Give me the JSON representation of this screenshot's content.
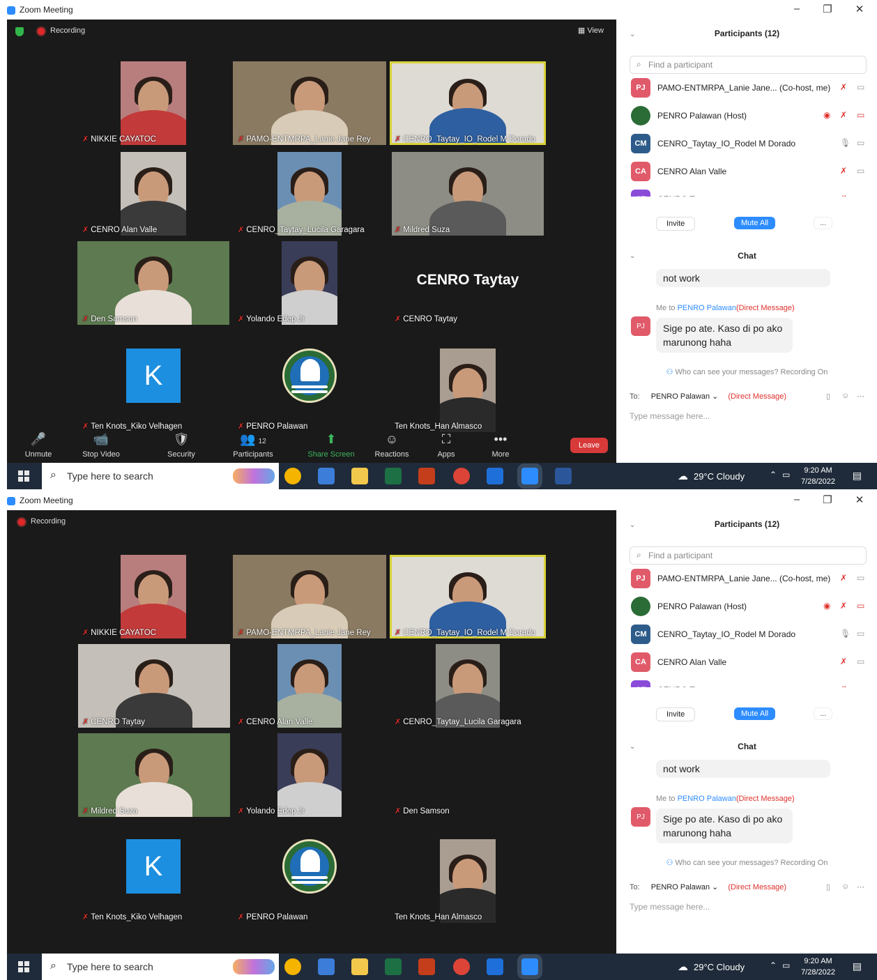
{
  "screens": [
    {
      "window_title": "Zoom Meeting",
      "recording_label": "Recording",
      "view_label": "View",
      "tiles": [
        {
          "name": "NIKKIE CAYATOC",
          "kind": "video"
        },
        {
          "name": "PAMO-ENTMRPA_Lanie Jane Rey",
          "kind": "video"
        },
        {
          "name": "CENRO_Taytay_IO_Rodel M Dorado",
          "kind": "video",
          "active": true
        },
        {
          "name": "CENRO Alan Valle",
          "kind": "video"
        },
        {
          "name": "CENRO_Taytay_Lucila Garagara",
          "kind": "video"
        },
        {
          "name": "Mildred Suza",
          "kind": "video"
        },
        {
          "name": "Den Samson",
          "kind": "video"
        },
        {
          "name": "Yolando Edep Jr",
          "kind": "video"
        },
        {
          "name": "CENRO Taytay",
          "kind": "name",
          "big_text": "CENRO Taytay"
        },
        {
          "name": "Ten Knots_Kiko Velhagen",
          "kind": "initial",
          "initial": "K"
        },
        {
          "name": "PENRO Palawan",
          "kind": "logo"
        },
        {
          "name": "Ten Knots_Han Almasco",
          "kind": "video",
          "no_mic": true
        }
      ],
      "controls": [
        {
          "label": "Unmute",
          "icon": "🎤"
        },
        {
          "label": "Stop Video",
          "icon": "📹"
        },
        {
          "label": "Security",
          "icon": "🛡"
        },
        {
          "label": "Participants",
          "icon": "👥",
          "count": "12"
        },
        {
          "label": "Share Screen",
          "icon": "⬆",
          "green": true
        },
        {
          "label": "Reactions",
          "icon": "☺"
        },
        {
          "label": "Apps",
          "icon": "⛶"
        },
        {
          "label": "More",
          "icon": "•••"
        }
      ],
      "leave_label": "Leave",
      "participants_title": "Participants (12)",
      "find_placeholder": "Find a participant",
      "participants": [
        {
          "initials": "PJ",
          "name": "PAMO-ENTMRPA_Lanie Jane... (Co-host, me)",
          "color": "#e05a6a"
        },
        {
          "initials": "",
          "name": "PENRO Palawan (Host)",
          "color": "#2a6b36",
          "logo": true
        },
        {
          "initials": "CM",
          "name": "CENRO_Taytay_IO_Rodel M Dorado",
          "color": "#2e5c8a"
        },
        {
          "initials": "CA",
          "name": "CENRO Alan Valle",
          "color": "#e05a6a"
        },
        {
          "initials": "CT",
          "name": "CENRO Taytay",
          "color": "#8a4bd8"
        }
      ],
      "invite_label": "Invite",
      "mute_all_label": "Mute All",
      "more_label": "...",
      "chat_title": "Chat",
      "chat_prev": "not work",
      "chat_meta_prefix": "Me to",
      "chat_meta_target": "PENRO Palawan",
      "chat_meta_suffix": "(Direct Message)",
      "chat_avatar": "PJ",
      "chat_msg": "Sige po ate. Kaso di po ako marunong haha",
      "who_can_see": "Who can see your messages? Recording On",
      "to_label": "To:",
      "to_target": "PENRO Palawan ⌄",
      "to_dm": "(Direct Message)",
      "message_placeholder": "Type message here...",
      "taskbar_search": "Type here to search",
      "weather": "29°C  Cloudy",
      "time": "9:20 AM",
      "date": "7/28/2022"
    },
    {
      "window_title": "Zoom Meeting",
      "recording_label": "Recording",
      "view_label": "",
      "tiles": [
        {
          "name": "NIKKIE CAYATOC",
          "kind": "video"
        },
        {
          "name": "PAMO-ENTMRPA_Lanie Jane Rey",
          "kind": "video"
        },
        {
          "name": "CENRO_Taytay_IO_Rodel M Dorado",
          "kind": "video",
          "active": true
        },
        {
          "name": "CENRO Taytay",
          "kind": "video"
        },
        {
          "name": "CENRO Alan Valle",
          "kind": "video"
        },
        {
          "name": "CENRO_Taytay_Lucila Garagara",
          "kind": "video"
        },
        {
          "name": "Mildred Suza",
          "kind": "video"
        },
        {
          "name": "Yolando Edep Jr",
          "kind": "video"
        },
        {
          "name": "Den Samson",
          "kind": "empty"
        },
        {
          "name": "Ten Knots_Kiko Velhagen",
          "kind": "initial",
          "initial": "K"
        },
        {
          "name": "PENRO Palawan",
          "kind": "logo"
        },
        {
          "name": "Ten Knots_Han Almasco",
          "kind": "video",
          "no_mic": true
        }
      ],
      "controls": [],
      "leave_label": "",
      "participants_title": "Participants (12)",
      "find_placeholder": "Find a participant",
      "participants": [
        {
          "initials": "PJ",
          "name": "PAMO-ENTMRPA_Lanie Jane... (Co-host, me)",
          "color": "#e05a6a"
        },
        {
          "initials": "",
          "name": "PENRO Palawan (Host)",
          "color": "#2a6b36",
          "logo": true
        },
        {
          "initials": "CM",
          "name": "CENRO_Taytay_IO_Rodel M Dorado",
          "color": "#2e5c8a"
        },
        {
          "initials": "CA",
          "name": "CENRO Alan Valle",
          "color": "#e05a6a"
        },
        {
          "initials": "CT",
          "name": "CENRO Taytay",
          "color": "#8a4bd8"
        }
      ],
      "invite_label": "Invite",
      "mute_all_label": "Mute All",
      "more_label": "...",
      "chat_title": "Chat",
      "chat_prev": "not work",
      "chat_meta_prefix": "Me to",
      "chat_meta_target": "PENRO Palawan",
      "chat_meta_suffix": "(Direct Message)",
      "chat_avatar": "PJ",
      "chat_msg": "Sige po ate. Kaso di po ako marunong haha",
      "who_can_see": "Who can see your messages? Recording On",
      "to_label": "To:",
      "to_target": "PENRO Palawan ⌄",
      "to_dm": "(Direct Message)",
      "message_placeholder": "Type message here...",
      "taskbar_search": "Type here to search",
      "weather": "29°C  Cloudy",
      "time": "9:20 AM",
      "date": "7/28/2022"
    }
  ],
  "colors": {
    "meeting_bg": "#1a1a1a",
    "active_speaker": "#d8d23a",
    "leave": "#d83a3a",
    "accent_blue": "#2d8cff",
    "muted_red": "#e0302c",
    "taskbar": "#1f2b3a"
  }
}
